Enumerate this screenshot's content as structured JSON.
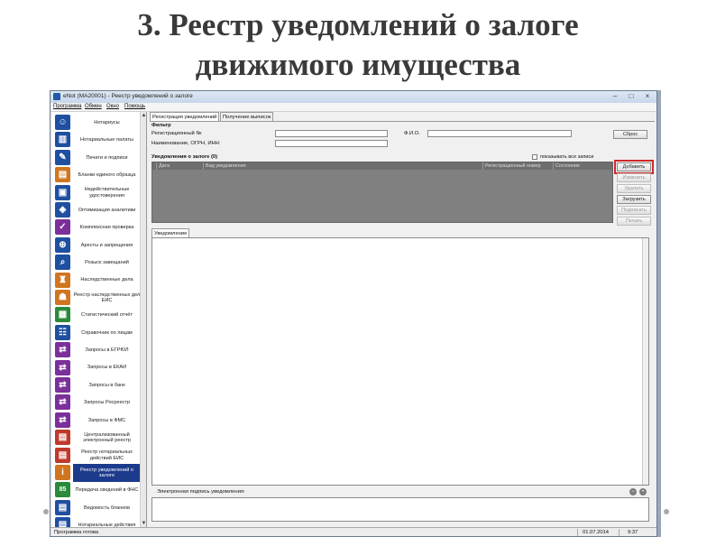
{
  "slide": {
    "title_line1": "3. Реестр уведомлений о залоге",
    "title_line2": "движимого имущества"
  },
  "window": {
    "title": "eNot (MA20001) - Реестр уведомлений о залоге",
    "controls": {
      "minimize": "–",
      "maximize": "□",
      "close": "×"
    },
    "menu": [
      "Программа",
      "Обмен",
      "Окно",
      "Помощь"
    ]
  },
  "sidebar": {
    "items": [
      {
        "label": "Нотариусы",
        "icon": "people-icon",
        "color": "#1f4fa0",
        "glyph": "☺",
        "active": false
      },
      {
        "label": "Нотариальные палаты",
        "icon": "building-icon",
        "color": "#1f4fa0",
        "glyph": "▥",
        "active": false
      },
      {
        "label": "Печати и подписи",
        "icon": "stamp-icon",
        "color": "#1f4fa0",
        "glyph": "✎",
        "active": false
      },
      {
        "label": "Бланки единого образца",
        "icon": "forms-icon",
        "color": "#d07520",
        "glyph": "▤",
        "active": false
      },
      {
        "label": "Недействительные удостоверения",
        "icon": "id-card-icon",
        "color": "#1f4fa0",
        "glyph": "▣",
        "active": false
      },
      {
        "label": "Оптимизация аналитики",
        "icon": "analytics-icon",
        "color": "#1f4fa0",
        "glyph": "◈",
        "active": false
      },
      {
        "label": "Комплексная проверка",
        "icon": "check-icon",
        "color": "#7a2f9a",
        "glyph": "✓",
        "active": false
      },
      {
        "label": "Аресты и запрещения",
        "icon": "lock-icon",
        "color": "#1f4fa0",
        "glyph": "⊕",
        "active": false
      },
      {
        "label": "Розыск завещаний",
        "icon": "search-icon",
        "color": "#1f4fa0",
        "glyph": "⌕",
        "active": false
      },
      {
        "label": "Наследственные дела",
        "icon": "inheritance-icon",
        "color": "#d07520",
        "glyph": "♜",
        "active": false
      },
      {
        "label": "Реестр наследственных дел ЕИС",
        "icon": "registry-icon",
        "color": "#d07520",
        "glyph": "☗",
        "active": false
      },
      {
        "label": "Статистический отчёт",
        "icon": "report-icon",
        "color": "#2a8a3a",
        "glyph": "▦",
        "active": false
      },
      {
        "label": "Справочник по лицам",
        "icon": "persons-icon",
        "color": "#1f4fa0",
        "glyph": "☷",
        "active": false
      },
      {
        "label": "Запросы в ЕГРЮЛ",
        "icon": "query-icon",
        "color": "#7a2f9a",
        "glyph": "⇄",
        "active": false
      },
      {
        "label": "Запросы в ЕКАИ",
        "icon": "query-icon",
        "color": "#7a2f9a",
        "glyph": "⇄",
        "active": false
      },
      {
        "label": "Запросы в банк",
        "icon": "bank-icon",
        "color": "#7a2f9a",
        "glyph": "⇄",
        "active": false
      },
      {
        "label": "Запросы Росреестр",
        "icon": "query-icon",
        "color": "#7a2f9a",
        "glyph": "⇄",
        "active": false
      },
      {
        "label": "Запросы в ФМС",
        "icon": "query-icon",
        "color": "#7a2f9a",
        "glyph": "⇄",
        "active": false
      },
      {
        "label": "Централизованный электронный реестр",
        "icon": "registry-icon",
        "color": "#c0392b",
        "glyph": "▤",
        "active": false
      },
      {
        "label": "Реестр нотариальных действий ЕИС",
        "icon": "registry-icon",
        "color": "#c0392b",
        "glyph": "▤",
        "active": false
      },
      {
        "label": "Реестр уведомлений о залоге",
        "icon": "pledge-icon",
        "color": "#d07520",
        "glyph": "i",
        "active": true
      },
      {
        "label": "Передача сведений в ФНС",
        "icon": "transfer-icon",
        "color": "#2a8a3a",
        "glyph": "85",
        "active": false
      },
      {
        "label": "Ведомость бланков",
        "icon": "sheet-icon",
        "color": "#1f4fa0",
        "glyph": "▤",
        "active": false
      },
      {
        "label": "Нотариальные действия",
        "icon": "actions-icon",
        "color": "#1f4fa0",
        "glyph": "▤",
        "active": false
      }
    ]
  },
  "tabs": [
    {
      "label": "Регистрация уведомлений",
      "selected": true
    },
    {
      "label": "Получение выписок",
      "selected": false
    }
  ],
  "filter": {
    "title": "Фильтр",
    "reg_number_label": "Регистрационный №",
    "reg_number_value": "",
    "name_label": "Наименование, ОГРН, ИНН:",
    "name_value": "",
    "fio_label": "Ф.И.О.",
    "fio_value": "",
    "search_button": "Сброс"
  },
  "notices": {
    "title": "Уведомления о залоге (0)",
    "checkbox_label": "показывать все записи",
    "checked": false,
    "columns": [
      "Дата",
      "Вид уведомления",
      "Регистрационный номер",
      "Состояние"
    ]
  },
  "actions": {
    "add": "Добавить",
    "edit": "Изменить",
    "delete": "Удалить",
    "upload": "Загрузить",
    "sign": "Подписать",
    "print": "Печать"
  },
  "detail_tab": "Уведомление",
  "signature_label": "Электронная подпись уведомления:",
  "statusbar": {
    "left": "Программа готова",
    "date": "01.07.2014",
    "time": "9:37"
  }
}
